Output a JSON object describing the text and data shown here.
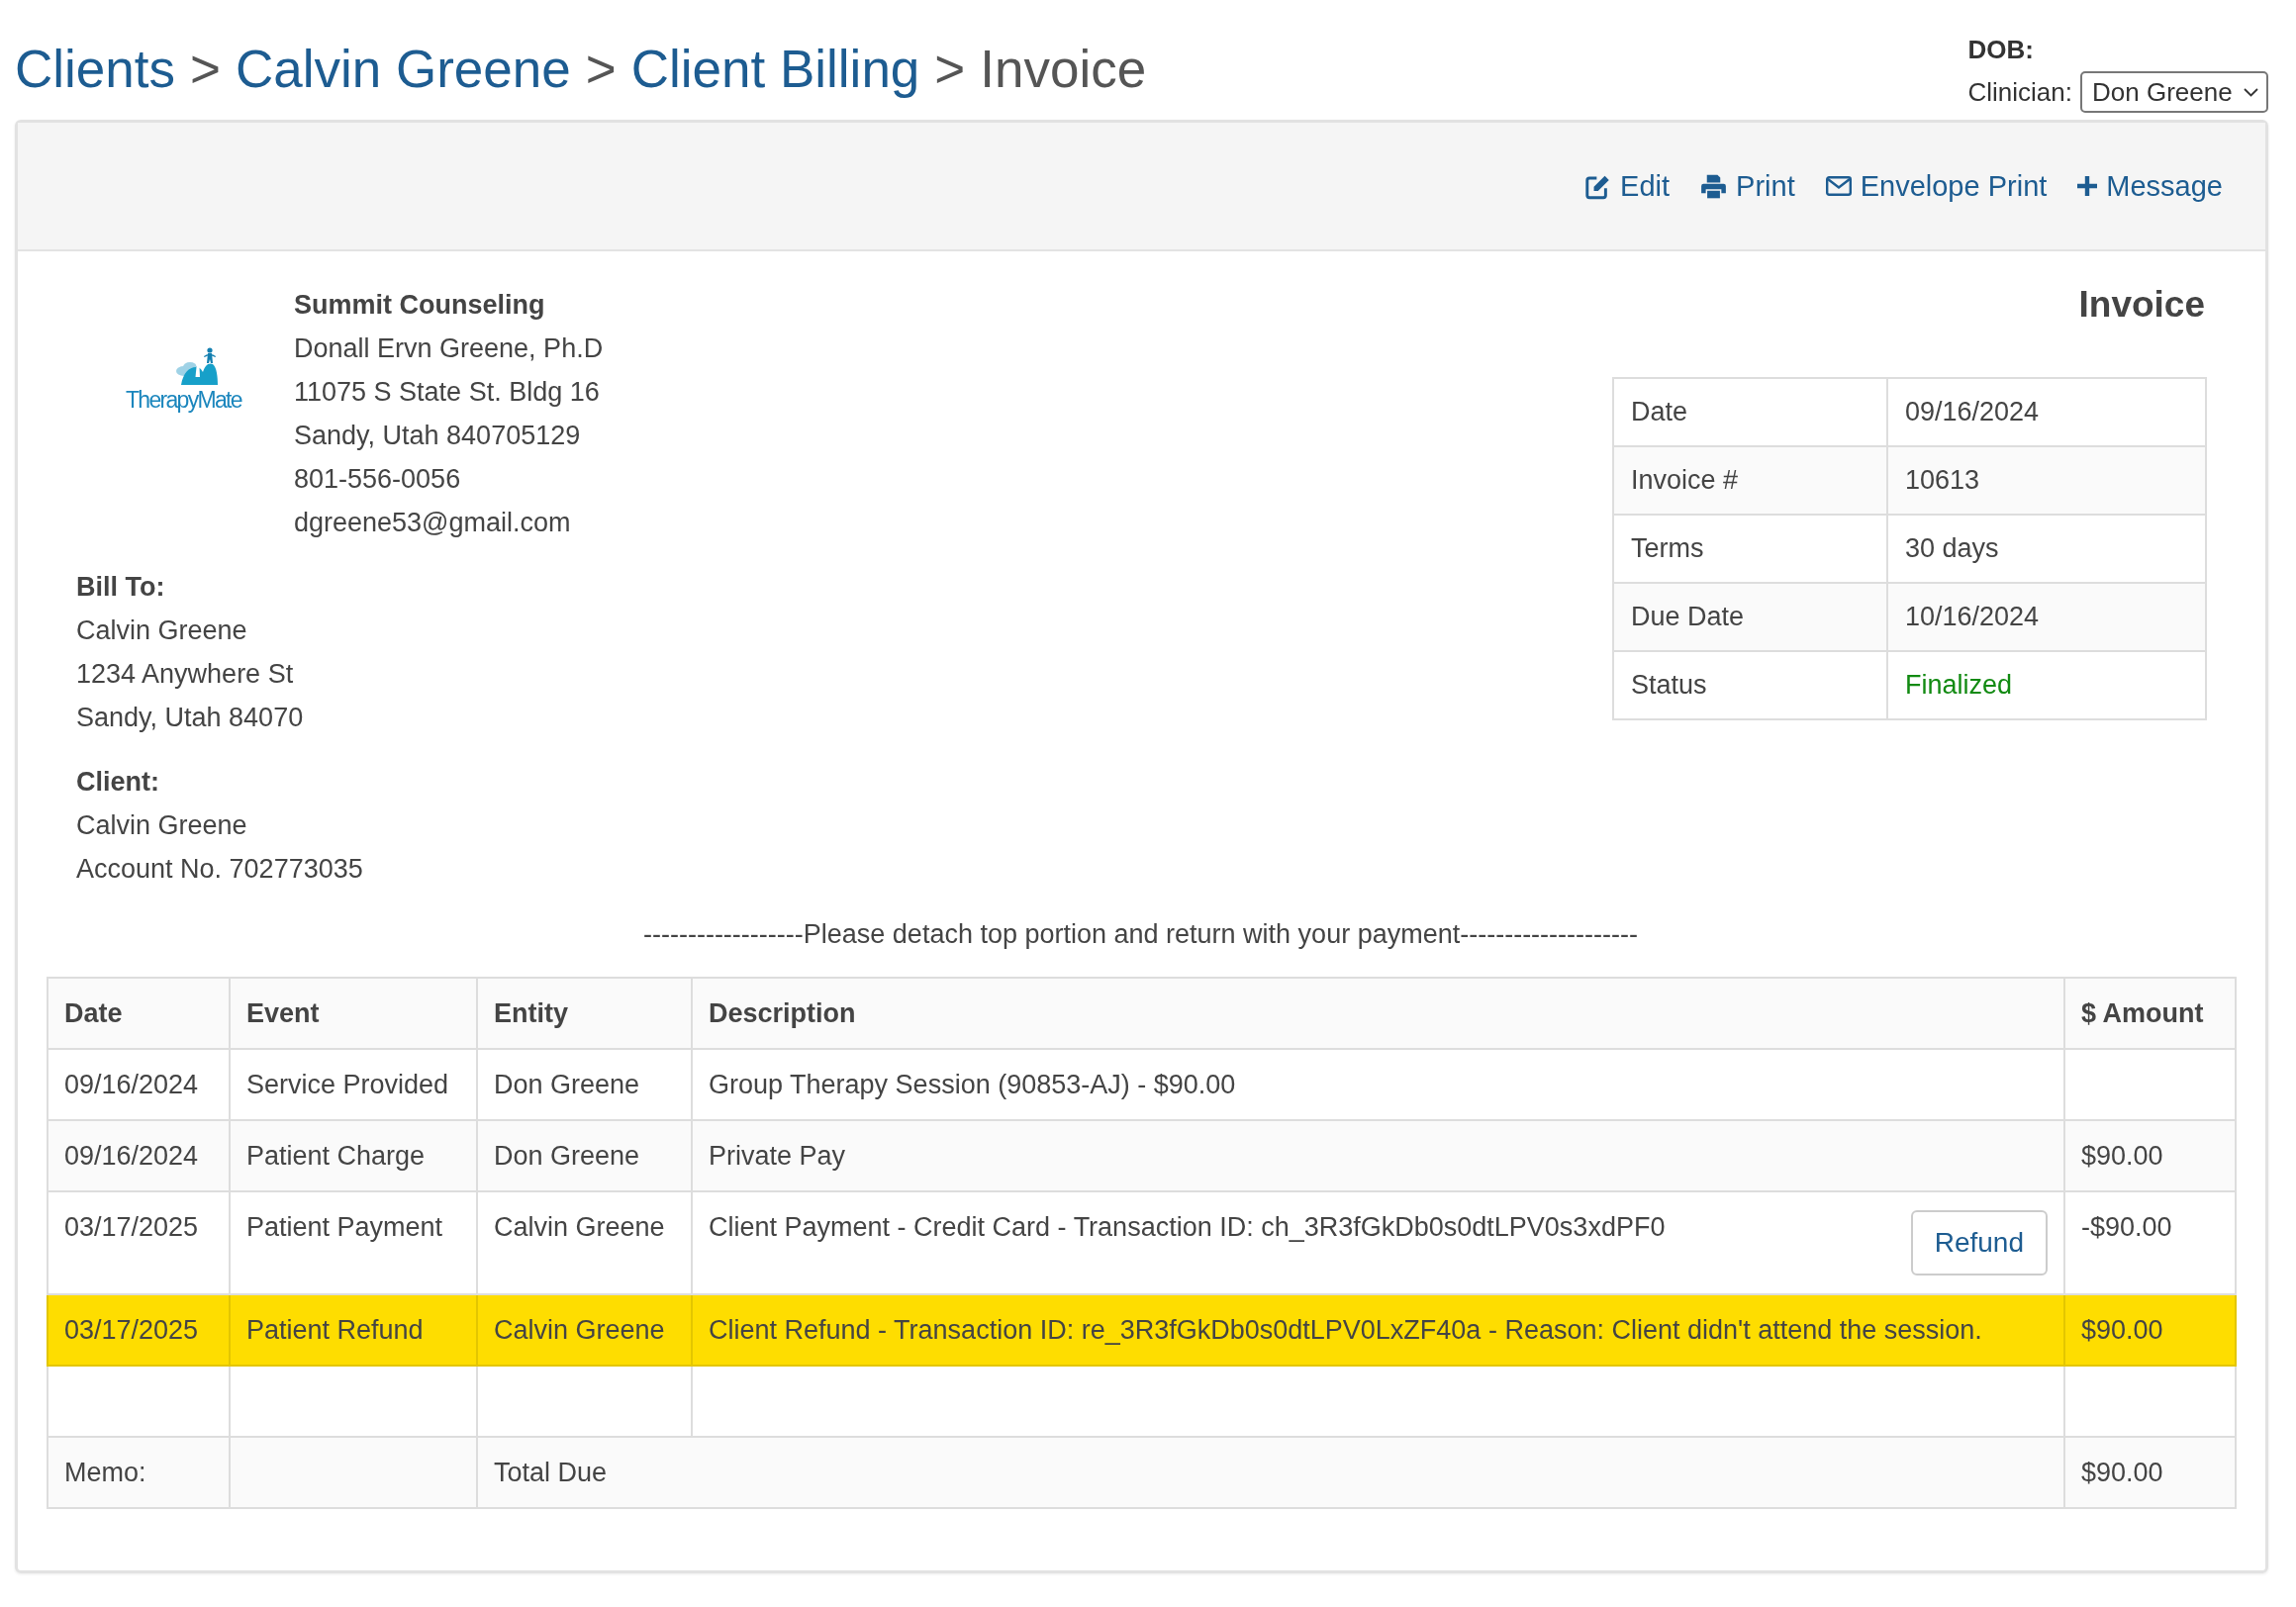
{
  "breadcrumb": [
    {
      "kind": "link",
      "label": "Clients"
    },
    {
      "kind": "separator",
      "label": ">"
    },
    {
      "kind": "link",
      "label": "Calvin Greene"
    },
    {
      "kind": "separator",
      "label": ">"
    },
    {
      "kind": "link",
      "label": "Client Billing"
    },
    {
      "kind": "separator",
      "label": ">"
    },
    {
      "kind": "current",
      "label": "Invoice"
    }
  ],
  "patient_info": {
    "dob_label": "DOB:",
    "clinician_label": "Clinician:",
    "clinician_select": {
      "value": "Don Greene"
    }
  },
  "toolbar": [
    {
      "kind": "edit",
      "label": "Edit"
    },
    {
      "kind": "print",
      "label": "Print"
    },
    {
      "kind": "envelope",
      "label": "Envelope Print"
    },
    {
      "kind": "message",
      "label": "Message"
    }
  ],
  "practice": {
    "logo_text": "TherapyMate",
    "name": "Summit Counseling",
    "lines": [
      "Donall Ervn Greene, Ph.D",
      "11075 S State St. Bldg 16",
      "Sandy, Utah 840705129",
      "801-556-0056",
      "dgreene53@gmail.com"
    ]
  },
  "bill_to": {
    "heading": "Bill To:",
    "lines": [
      "Calvin Greene",
      "1234 Anywhere St",
      "Sandy, Utah 84070"
    ]
  },
  "client": {
    "heading": "Client:",
    "lines": [
      "Calvin Greene",
      "Account No. 702773035"
    ]
  },
  "invoice": {
    "title": "Invoice",
    "fields": [
      {
        "kind": "text",
        "label": "Date",
        "value": "09/16/2024"
      },
      {
        "kind": "text",
        "label": "Invoice #",
        "value": "10613"
      },
      {
        "kind": "text",
        "label": "Terms",
        "value": "30 days"
      },
      {
        "kind": "text",
        "label": "Due Date",
        "value": "10/16/2024"
      },
      {
        "kind": "status",
        "label": "Status",
        "value": "Finalized"
      }
    ]
  },
  "detach_note": "------------------Please detach top portion and return with your payment--------------------",
  "transactions": {
    "columns": [
      "Date",
      "Event",
      "Entity",
      "Description",
      "$ Amount"
    ],
    "rows": [
      {
        "kind": "entry",
        "highlighted": false,
        "date": "09/16/2024",
        "event": "Service Provided",
        "entity": "Don Greene",
        "description": "Group Therapy Session (90853-AJ) - $90.00"
      },
      {
        "kind": "entry",
        "highlighted": false,
        "date": "09/16/2024",
        "event": "Patient Charge",
        "entity": "Don Greene",
        "description": "Private Pay",
        "amount": "$90.00"
      },
      {
        "kind": "entry",
        "highlighted": false,
        "date": "03/17/2025",
        "event": "Patient Payment",
        "entity": "Calvin Greene",
        "description": "Client Payment - Credit Card - Transaction ID: ch_3R3fGkDb0s0dtLPV0s3xdPF0",
        "action": "Refund",
        "amount": "-$90.00"
      },
      {
        "kind": "entry",
        "highlighted": true,
        "date": "03/17/2025",
        "event": "Patient Refund",
        "entity": "Calvin Greene",
        "description": "Client Refund - Transaction ID: re_3R3fGkDb0s0dtLPV0LxZF40a - Reason: Client didn't attend the session.",
        "amount": "$90.00"
      },
      {
        "kind": "blank"
      }
    ],
    "footer": {
      "memo_label": "Memo:",
      "total_label": "Total Due",
      "total": "$90.00"
    }
  }
}
